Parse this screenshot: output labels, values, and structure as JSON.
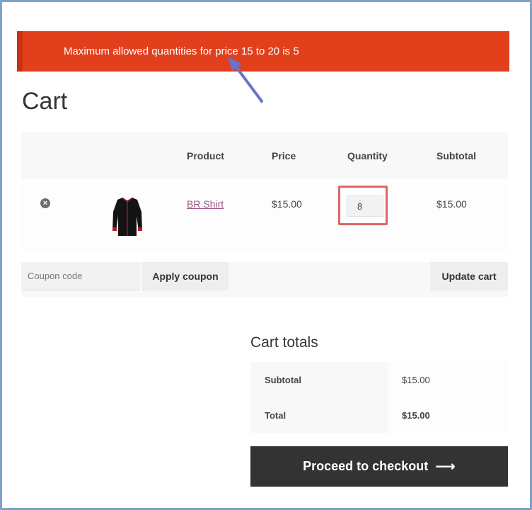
{
  "notice": {
    "message": "Maximum allowed quantities for price 15 to 20 is 5",
    "background": "#e2401c"
  },
  "page_title": "Cart",
  "table": {
    "headers": {
      "product": "Product",
      "price": "Price",
      "quantity": "Quantity",
      "subtotal": "Subtotal"
    },
    "rows": [
      {
        "remove_icon": "close-circle-icon",
        "product": "BR Shirt",
        "price": "$15.00",
        "quantity": "8",
        "subtotal": "$15.00"
      }
    ]
  },
  "actions": {
    "coupon_placeholder": "Coupon code",
    "apply_label": "Apply coupon",
    "update_label": "Update cart"
  },
  "totals": {
    "title": "Cart totals",
    "subtotal_label": "Subtotal",
    "subtotal_value": "$15.00",
    "total_label": "Total",
    "total_value": "$15.00"
  },
  "checkout": {
    "label": "Proceed to checkout",
    "arrow": "⟶"
  },
  "colors": {
    "checkout_bg": "#333333",
    "link": "#96588a",
    "highlight": "#e06666",
    "annotation_arrow": "#6a72c9"
  }
}
